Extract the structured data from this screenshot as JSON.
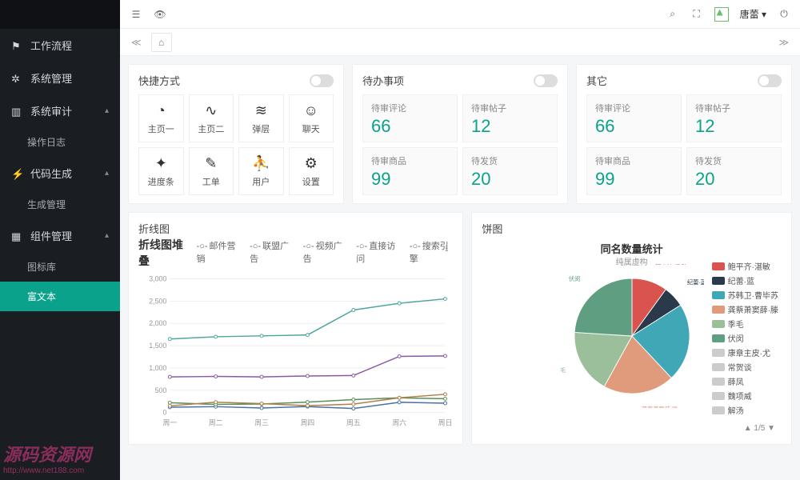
{
  "sidebar": {
    "items": [
      {
        "label": "工作流程",
        "icon": "flag"
      },
      {
        "label": "系统管理",
        "icon": "gears"
      },
      {
        "label": "系统审计",
        "icon": "chart",
        "expanded": true,
        "children": [
          {
            "label": "操作日志"
          }
        ]
      },
      {
        "label": "代码生成",
        "icon": "bolt",
        "expanded": true,
        "children": [
          {
            "label": "生成管理"
          }
        ]
      },
      {
        "label": "组件管理",
        "icon": "grid",
        "expanded": true,
        "children": [
          {
            "label": "图标库"
          },
          {
            "label": "富文本",
            "active": true
          }
        ]
      }
    ]
  },
  "header": {
    "username": "唐蕾"
  },
  "cards": {
    "quick": {
      "title": "快捷方式",
      "cells": [
        {
          "label": "主页一",
          "icon": "gauge"
        },
        {
          "label": "主页二",
          "icon": "pulse"
        },
        {
          "label": "弹层",
          "icon": "layers"
        },
        {
          "label": "聊天",
          "icon": "face"
        },
        {
          "label": "进度条",
          "icon": "compass"
        },
        {
          "label": "工单",
          "icon": "doc"
        },
        {
          "label": "用户",
          "icon": "user"
        },
        {
          "label": "设置",
          "icon": "gear"
        }
      ]
    },
    "todo": {
      "title": "待办事项",
      "stats": [
        {
          "label": "待审评论",
          "value": "66"
        },
        {
          "label": "待审帖子",
          "value": "12"
        },
        {
          "label": "待审商品",
          "value": "99"
        },
        {
          "label": "待发货",
          "value": "20"
        }
      ]
    },
    "other": {
      "title": "其它",
      "stats": [
        {
          "label": "待审评论",
          "value": "66"
        },
        {
          "label": "待审帖子",
          "value": "12"
        },
        {
          "label": "待审商品",
          "value": "99"
        },
        {
          "label": "待发货",
          "value": "20"
        }
      ]
    }
  },
  "lineChart": {
    "panelTitle": "折线图",
    "title": "折线图堆叠",
    "legend": [
      "邮件营销",
      "联盟广告",
      "视频广告",
      "直接访问",
      "搜索引擎"
    ]
  },
  "pieChart": {
    "panelTitle": "饼图",
    "title": "同名数量统计",
    "subtitle": "纯属虚构",
    "pager": "1/5",
    "legendLeft": [
      "鲍平齐·湛敏",
      "纪蕾·蓝",
      "苏韩卫·曹毕苏",
      "龚蔡萧窦薛·滕",
      "季毛",
      "伏闵"
    ],
    "legendRight": [
      "康章主皮·尤",
      "常贺谈",
      "薛凤",
      "魏项威",
      "解汤"
    ]
  },
  "watermark": {
    "big": "源码资源网",
    "small": "http://www.net188.com"
  },
  "chart_data": {
    "line": {
      "type": "line",
      "title": "折线图堆叠",
      "x": [
        "周一",
        "周二",
        "周三",
        "周四",
        "周五",
        "周六",
        "周日"
      ],
      "ylim": [
        0,
        3000
      ],
      "series": [
        {
          "name": "邮件营销",
          "values": [
            120,
            132,
            101,
            134,
            90,
            230,
            210
          ]
        },
        {
          "name": "联盟广告",
          "values": [
            220,
            182,
            191,
            234,
            290,
            330,
            310
          ]
        },
        {
          "name": "视频广告",
          "values": [
            150,
            232,
            201,
            154,
            190,
            330,
            410
          ]
        },
        {
          "name": "直接访问",
          "values": [
            800,
            810,
            800,
            820,
            830,
            1260,
            1270
          ]
        },
        {
          "name": "搜索引擎",
          "values": [
            1650,
            1700,
            1720,
            1740,
            2300,
            2450,
            2550
          ]
        }
      ]
    },
    "pie": {
      "type": "pie",
      "title": "同名数量统计",
      "slices": [
        {
          "name": "鲍平齐·湛敏",
          "value": 10,
          "color": "#d9534f"
        },
        {
          "name": "纪蕾·蓝",
          "value": 6,
          "color": "#2b3a4a"
        },
        {
          "name": "苏韩卫·曹毕苏",
          "value": 22,
          "color": "#3fa7b6"
        },
        {
          "name": "龚蔡萧窦薛·滕",
          "value": 20,
          "color": "#e09b7d"
        },
        {
          "name": "季毛",
          "value": 18,
          "color": "#9bbf9b"
        },
        {
          "name": "伏闵",
          "value": 24,
          "color": "#5f9e80"
        }
      ]
    }
  }
}
